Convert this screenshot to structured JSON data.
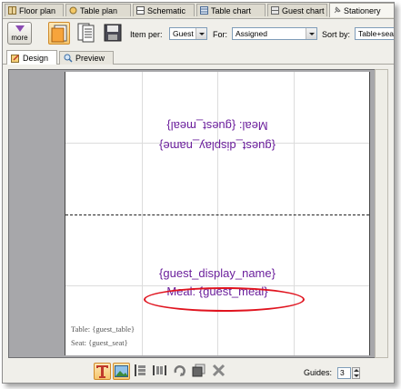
{
  "tabs": [
    {
      "label": "Floor plan",
      "active": false
    },
    {
      "label": "Table plan",
      "active": false
    },
    {
      "label": "Schematic",
      "active": false
    },
    {
      "label": "Table chart",
      "active": false
    },
    {
      "label": "Guest chart",
      "active": false
    },
    {
      "label": "Stationery",
      "active": true
    }
  ],
  "toolbar": {
    "more_label": "more",
    "item_per_label": "Item per:",
    "item_per_value": "Guest",
    "for_label": "For:",
    "for_value": "Assigned",
    "sort_by_label": "Sort by:",
    "sort_by_value": "Table+seat"
  },
  "view_tabs": [
    {
      "label": "Design",
      "active": true
    },
    {
      "label": "Preview",
      "active": false
    }
  ],
  "card": {
    "top_line1": "Meal: {guest_meal}",
    "top_line2": "{guest_display_name}",
    "bottom_name": "{guest_display_name}",
    "bottom_meal": "Meal: {guest_meal}",
    "table_text": "Table: {guest_table}",
    "seat_text": "Seat: {guest_seat}"
  },
  "bottom_toolbar": {
    "guides_label": "Guides:",
    "guides_value": "3"
  },
  "colors": {
    "placeholder_text": "#6b1f9c",
    "highlight_ellipse": "#e0141f",
    "selected_button": "#f6c66e"
  }
}
